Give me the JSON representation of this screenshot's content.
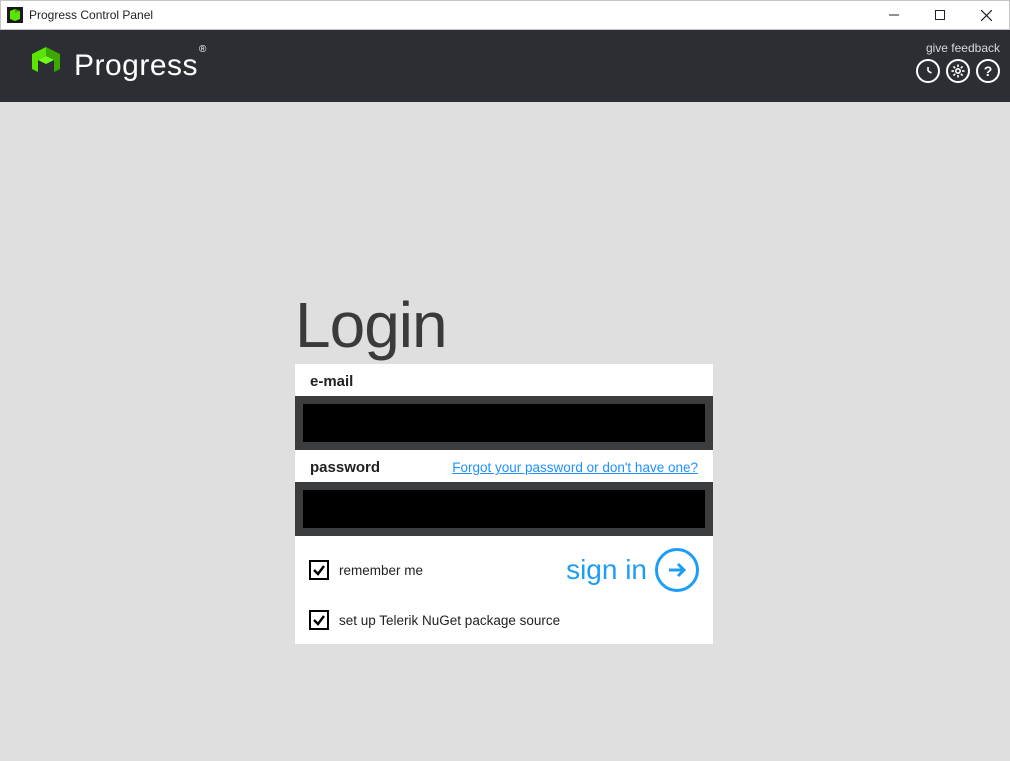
{
  "titlebar": {
    "title": "Progress Control Panel"
  },
  "header": {
    "brand": "Progress",
    "feedback_label": "give feedback",
    "icons": {
      "clock": "clock-icon",
      "gear": "gear-icon",
      "help": "help-icon"
    }
  },
  "login": {
    "title": "Login",
    "email_label": "e-mail",
    "email_value": "",
    "password_label": "password",
    "forgot_label": "Forgot your password or don't have one?",
    "password_value": "",
    "remember_label": "remember me",
    "remember_checked": true,
    "nuget_label": "set up Telerik NuGet package source",
    "nuget_checked": true,
    "signin_label": "sign in"
  },
  "colors": {
    "header_bg": "#2b2f33",
    "accent_green": "#5ce500",
    "accent_blue": "#1e9df7",
    "link_blue": "#1e90ff",
    "body_bg": "#dfdfdf"
  }
}
